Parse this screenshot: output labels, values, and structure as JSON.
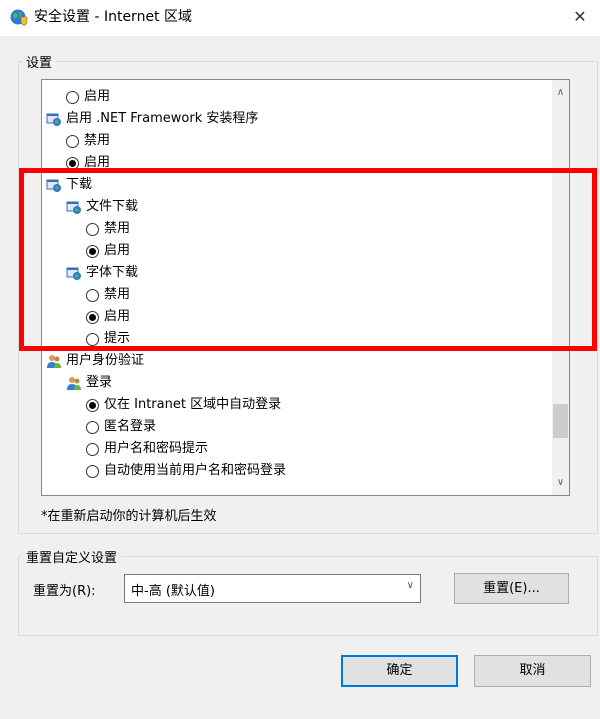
{
  "window": {
    "title": "安全设置 - Internet 区域",
    "close_glyph": "✕"
  },
  "settings_group": {
    "label": "设置"
  },
  "tree": [
    {
      "type": "radio",
      "label": "启用",
      "checked": false,
      "indent": 1
    },
    {
      "type": "node",
      "label": "启用 .NET Framework 安装程序",
      "indent": 0
    },
    {
      "type": "radio",
      "label": "禁用",
      "checked": false,
      "indent": 1
    },
    {
      "type": "radio",
      "label": "启用",
      "checked": true,
      "indent": 1
    },
    {
      "type": "node",
      "label": "下载",
      "indent": 0
    },
    {
      "type": "node",
      "label": "文件下载",
      "indent": 1
    },
    {
      "type": "radio",
      "label": "禁用",
      "checked": false,
      "indent": 2
    },
    {
      "type": "radio",
      "label": "启用",
      "checked": true,
      "indent": 2
    },
    {
      "type": "node",
      "label": "字体下载",
      "indent": 1
    },
    {
      "type": "radio",
      "label": "禁用",
      "checked": false,
      "indent": 2
    },
    {
      "type": "radio",
      "label": "启用",
      "checked": true,
      "indent": 2
    },
    {
      "type": "radio",
      "label": "提示",
      "checked": false,
      "indent": 2
    },
    {
      "type": "node",
      "label": "用户身份验证",
      "indent": 0,
      "icon": "users"
    },
    {
      "type": "node",
      "label": "登录",
      "indent": 1,
      "icon": "users"
    },
    {
      "type": "radio",
      "label": "仅在 Intranet 区域中自动登录",
      "checked": true,
      "indent": 2
    },
    {
      "type": "radio",
      "label": "匿名登录",
      "checked": false,
      "indent": 2
    },
    {
      "type": "radio",
      "label": "用户名和密码提示",
      "checked": false,
      "indent": 2
    },
    {
      "type": "radio",
      "label": "自动使用当前用户名和密码登录",
      "checked": false,
      "indent": 2
    }
  ],
  "scrollbar": {
    "up": "∧",
    "down": "∨",
    "position": 0.9
  },
  "restart_note": "*在重新启动你的计算机后生效",
  "reset_group": {
    "label": "重置自定义设置",
    "reset_to_label": "重置为(R):",
    "combo_value": "中-高 (默认值)",
    "combo_arrow": "∨",
    "reset_button": "重置(E)..."
  },
  "buttons": {
    "ok": "确定",
    "cancel": "取消"
  },
  "colors": {
    "highlight": "#ff0000",
    "default_button_border": "#0078d7"
  }
}
